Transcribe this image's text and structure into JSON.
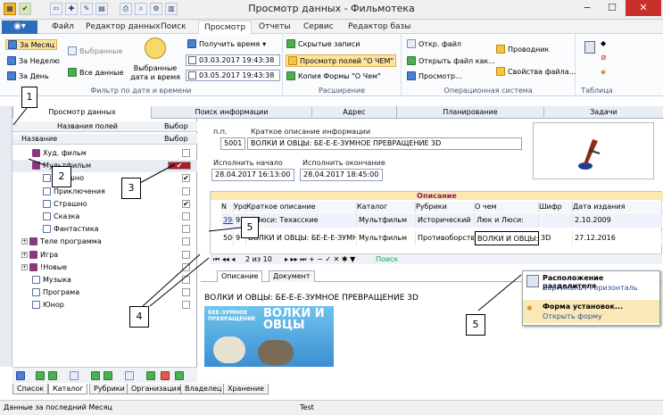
{
  "window": {
    "title": "Просмотр данных - Фильмотека",
    "controls": [
      "−",
      "☐",
      "✕"
    ]
  },
  "ribbon_tabs": [
    "Файл",
    "Редактор данных",
    "Поиск",
    "Просмотр",
    "Отчеты",
    "Сервис",
    "Редактор базы"
  ],
  "ribbon": {
    "filter": {
      "month": "За Месяц",
      "week": "За Неделю",
      "day": "За День",
      "selected": "Выбранные",
      "all": "Все данные",
      "date_time_l1": "Выбранные",
      "date_time_l2": "дата и время",
      "get_time": "Получить время",
      "date_from": "03.03.2017 19:43:38",
      "date_to": "03.05.2017 19:43:38",
      "label": "Фильтр по дате и времени"
    },
    "expansion": {
      "hidden": "Скрытые записи",
      "view_fields": "Просмотр полей \"О ЧЕМ\"",
      "copy_form": "Копия Формы \"О Чем\"",
      "label": "Расширение"
    },
    "os": {
      "open_file": "Откр. файл",
      "open_file_as": "Открыть файл как...",
      "view": "Просмотр...",
      "explorer": "Проводник",
      "file_props": "Свойства файла...",
      "label": "Операционная система"
    },
    "table": {
      "label": "Таблица"
    }
  },
  "main_tabs": [
    "Просмотр данных",
    "Поиск информации",
    "Адрес",
    "Планирование",
    "Задачи"
  ],
  "left_panel": {
    "col_fields": "Названия полей",
    "col_select": "Выбор",
    "col_name": "Название",
    "col_select2": "Выбор",
    "rows": [
      {
        "label": "Худ. фильм",
        "level": 1,
        "checked": false,
        "type": "book"
      },
      {
        "label": "Мультфильм",
        "level": 1,
        "checked": true,
        "type": "book",
        "selected": true
      },
      {
        "label": "Смешно",
        "level": 2,
        "checked": true,
        "type": "doc"
      },
      {
        "label": "Приключения",
        "level": 2,
        "checked": false,
        "type": "doc"
      },
      {
        "label": "Страшно",
        "level": 2,
        "checked": true,
        "type": "doc"
      },
      {
        "label": "Сказка",
        "level": 2,
        "checked": false,
        "type": "doc"
      },
      {
        "label": "Фантастика",
        "level": 2,
        "checked": false,
        "type": "doc"
      },
      {
        "label": "Теле программа",
        "level": 0,
        "checked": false,
        "type": "book"
      },
      {
        "label": "Игра",
        "level": 0,
        "checked": false,
        "type": "book"
      },
      {
        "label": "!Новые",
        "level": 0,
        "checked": false,
        "type": "book"
      },
      {
        "label": "Музыка",
        "level": 1,
        "checked": false,
        "type": "doc"
      },
      {
        "label": "Програма",
        "level": 1,
        "checked": false,
        "type": "doc"
      },
      {
        "label": "Юнор",
        "level": 1,
        "checked": false,
        "type": "doc"
      }
    ]
  },
  "callouts": [
    "1",
    "2",
    "3",
    "4",
    "5",
    "5"
  ],
  "detail": {
    "pp_label": "п.п.",
    "pp_value": "5001",
    "short_desc_label": "Краткое описание информации",
    "short_desc": "ВОЛКИ И ОВЦЫ: БЕ-Е-Е-ЗУМНОЕ ПРЕВРАЩЕНИЕ 3D",
    "start_label": "Исполнить начало",
    "start_value": "28.04.2017 16:13:00",
    "end_label": "Исполнить окончание",
    "end_value": "28.04.2017 18:45:00"
  },
  "grid": {
    "caption": "Описание",
    "headers": [
      "N",
      "Уро",
      "Краткое описание",
      "Каталог",
      "Рубрики",
      "О чем",
      "Шифр",
      "Дата издания"
    ],
    "rows": [
      [
        "3946",
        "9",
        "и Люси: Техасские",
        "Мультфильм",
        "Исторический",
        "Люк и Люси:",
        "",
        "2.10.2009"
      ],
      [
        "5001",
        "9",
        "ВОЛКИ И ОВЦЫ: БЕ-Е-Е-ЗУМНОЕ",
        "Мультфильм",
        "Противоборств",
        "ВОЛКИ И ОВЦЫ:",
        "3D",
        "27.12.2016"
      ]
    ],
    "pager": "2 из 10",
    "search": "Поиск"
  },
  "doc_tabs": [
    "Описание",
    "Документ"
  ],
  "doc_text": "ВОЛКИ И ОВЦЫ: БЕ-Е-Е-ЗУМНОЕ ПРЕВРАЩЕНИЕ 3D",
  "poster": {
    "line1": "БЕЕ-ЗУМНОЕ",
    "line2": "ПРЕВРАЩЕНИЕ",
    "logo": "ВОЛКИ И ОВЦЫ"
  },
  "popup": {
    "item1_title": "Расположение разделителя",
    "item1_sub": "Вертикаль / Горизонталь",
    "item2_title": "Форма установок...",
    "item2_sub": "Открыть форму"
  },
  "bottom_tabs": [
    "Список",
    "Каталог",
    "Рубрики",
    "Организация",
    "Владелец",
    "Хранение"
  ],
  "status": {
    "left": "Данные за последний Месяц",
    "center": "Test"
  }
}
